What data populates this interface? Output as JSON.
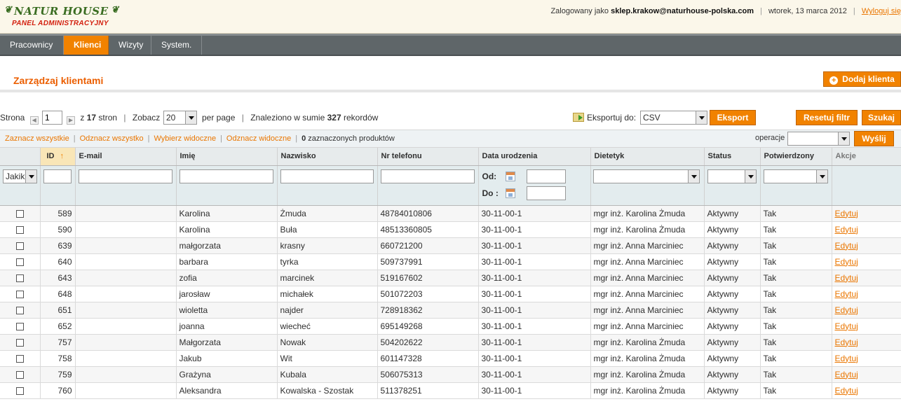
{
  "header": {
    "logo_title": "NATUR HOUSE",
    "logo_subtitle": "PANEL ADMINISTRACYJNY",
    "logged_as_label": "Zalogowany jako",
    "user_email": "sklep.krakow@naturhouse-polska.com",
    "date": "wtorek, 13 marca 2012",
    "logout_label": "Wyloguj się"
  },
  "nav": {
    "items": [
      {
        "label": "Pracownicy",
        "active": false
      },
      {
        "label": "Klienci",
        "active": true
      },
      {
        "label": "Wizyty",
        "active": false
      },
      {
        "label": "System.",
        "active": false
      }
    ]
  },
  "page": {
    "title": "Zarządzaj klientami",
    "add_button": "Dodaj klienta"
  },
  "pager": {
    "page_label": "Strona",
    "page_value": "1",
    "of_label": "z",
    "total_pages": "17",
    "pages_label": "stron",
    "view_label": "Zobacz",
    "per_page_value": "20",
    "per_page_label": "per page",
    "found_label": "Znaleziono w sumie",
    "found_count": "327",
    "records_label": "rekordów"
  },
  "export": {
    "label": "Eksportuj do:",
    "format": "CSV",
    "button": "Eksport"
  },
  "actions": {
    "reset_filter": "Resetuj filtr",
    "search": "Szukaj"
  },
  "massaction": {
    "select_all": "Zaznacz wszystkie",
    "unselect_all": "Odznacz wszystko",
    "select_visible": "Wybierz widoczne",
    "unselect_visible": "Odznacz widoczne",
    "selected_count": "0",
    "selected_label": "zaznaczonych produktów",
    "operations_label": "operacje",
    "operations_value": "",
    "submit": "Wyślij"
  },
  "grid": {
    "columns": [
      "ID",
      "E-mail",
      "Imię",
      "Nazwisko",
      "Nr telefonu",
      "Data urodzenia",
      "Dietetyk",
      "Status",
      "Potwierdzony",
      "Akcje"
    ],
    "filter": {
      "checkbox_select": "Jakik",
      "date_from_label": "Od:",
      "date_to_label": "Do :"
    },
    "rows": [
      {
        "id": "589",
        "email": "",
        "first": "Karolina",
        "last": "Żmuda",
        "phone": "48784010806",
        "birth": "30-11-00-1",
        "dietitian": "mgr inż. Karolina Żmuda",
        "status": "Aktywny",
        "confirmed": "Tak",
        "action": "Edytuj"
      },
      {
        "id": "590",
        "email": "",
        "first": "Karolina",
        "last": "Buła",
        "phone": "48513360805",
        "birth": "30-11-00-1",
        "dietitian": "mgr inż. Karolina Żmuda",
        "status": "Aktywny",
        "confirmed": "Tak",
        "action": "Edytuj"
      },
      {
        "id": "639",
        "email": "",
        "first": "małgorzata",
        "last": "krasny",
        "phone": "660721200",
        "birth": "30-11-00-1",
        "dietitian": "mgr inż. Anna Marciniec",
        "status": "Aktywny",
        "confirmed": "Tak",
        "action": "Edytuj"
      },
      {
        "id": "640",
        "email": "",
        "first": "barbara",
        "last": "tyrka",
        "phone": "509737991",
        "birth": "30-11-00-1",
        "dietitian": "mgr inż. Anna Marciniec",
        "status": "Aktywny",
        "confirmed": "Tak",
        "action": "Edytuj"
      },
      {
        "id": "643",
        "email": "",
        "first": "zofia",
        "last": "marcinek",
        "phone": "519167602",
        "birth": "30-11-00-1",
        "dietitian": "mgr inż. Anna Marciniec",
        "status": "Aktywny",
        "confirmed": "Tak",
        "action": "Edytuj"
      },
      {
        "id": "648",
        "email": "",
        "first": "jarosław",
        "last": "michałek",
        "phone": "501072203",
        "birth": "30-11-00-1",
        "dietitian": "mgr inż. Anna Marciniec",
        "status": "Aktywny",
        "confirmed": "Tak",
        "action": "Edytuj"
      },
      {
        "id": "651",
        "email": "",
        "first": "wioletta",
        "last": "najder",
        "phone": "728918362",
        "birth": "30-11-00-1",
        "dietitian": "mgr inż. Anna Marciniec",
        "status": "Aktywny",
        "confirmed": "Tak",
        "action": "Edytuj"
      },
      {
        "id": "652",
        "email": "",
        "first": "joanna",
        "last": "wiecheć",
        "phone": "695149268",
        "birth": "30-11-00-1",
        "dietitian": "mgr inż. Anna Marciniec",
        "status": "Aktywny",
        "confirmed": "Tak",
        "action": "Edytuj"
      },
      {
        "id": "757",
        "email": "",
        "first": "Małgorzata",
        "last": "Nowak",
        "phone": "504202622",
        "birth": "30-11-00-1",
        "dietitian": "mgr inż. Karolina Żmuda",
        "status": "Aktywny",
        "confirmed": "Tak",
        "action": "Edytuj"
      },
      {
        "id": "758",
        "email": "",
        "first": "Jakub",
        "last": "Wit",
        "phone": "601147328",
        "birth": "30-11-00-1",
        "dietitian": "mgr inż. Karolina Żmuda",
        "status": "Aktywny",
        "confirmed": "Tak",
        "action": "Edytuj"
      },
      {
        "id": "759",
        "email": "",
        "first": "Grażyna",
        "last": "Kubala",
        "phone": "506075313",
        "birth": "30-11-00-1",
        "dietitian": "mgr inż. Karolina Żmuda",
        "status": "Aktywny",
        "confirmed": "Tak",
        "action": "Edytuj"
      },
      {
        "id": "760",
        "email": "",
        "first": "Aleksandra",
        "last": "Kowalska - Szostak",
        "phone": "511378251",
        "birth": "30-11-00-1",
        "dietitian": "mgr inż. Karolina Żmuda",
        "status": "Aktywny",
        "confirmed": "Tak",
        "action": "Edytuj"
      }
    ]
  }
}
